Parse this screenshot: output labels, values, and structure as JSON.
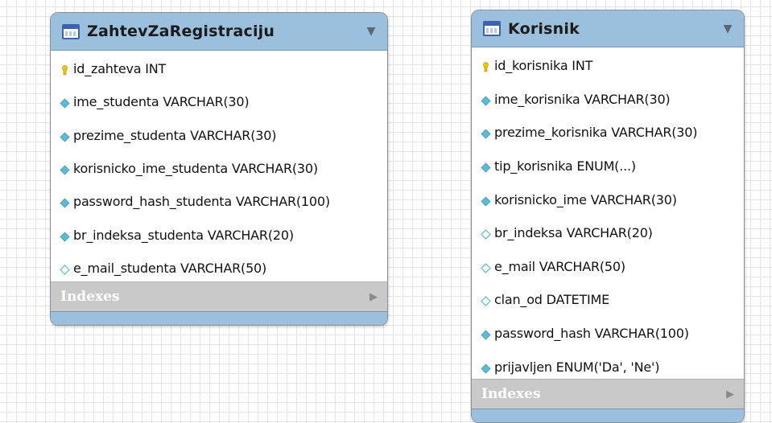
{
  "tables": [
    {
      "name": "ZahtevZaRegistraciju",
      "columns": [
        {
          "text": "id_zahteva INT",
          "marker": "primary-key-icon"
        },
        {
          "text": "ime_studenta VARCHAR(30)",
          "marker": "not-null-column-icon"
        },
        {
          "text": "prezime_studenta VARCHAR(30)",
          "marker": "not-null-column-icon"
        },
        {
          "text": "korisnicko_ime_studenta VARCHAR(30)",
          "marker": "not-null-column-icon"
        },
        {
          "text": "password_hash_studenta VARCHAR(100)",
          "marker": "not-null-column-icon"
        },
        {
          "text": "br_indeksa_studenta VARCHAR(20)",
          "marker": "not-null-column-icon"
        },
        {
          "text": "e_mail_studenta VARCHAR(50)",
          "marker": "nullable-column-icon"
        }
      ],
      "indexes_label": "Indexes"
    },
    {
      "name": "Korisnik",
      "columns": [
        {
          "text": "id_korisnika INT",
          "marker": "primary-key-icon"
        },
        {
          "text": "ime_korisnika VARCHAR(30)",
          "marker": "not-null-column-icon"
        },
        {
          "text": "prezime_korisnika VARCHAR(30)",
          "marker": "not-null-column-icon"
        },
        {
          "text": "tip_korisnika ENUM(...)",
          "marker": "not-null-column-icon"
        },
        {
          "text": "korisnicko_ime VARCHAR(30)",
          "marker": "not-null-column-icon"
        },
        {
          "text": "br_indeksa VARCHAR(20)",
          "marker": "nullable-column-icon"
        },
        {
          "text": "e_mail VARCHAR(50)",
          "marker": "nullable-column-icon"
        },
        {
          "text": "clan_od DATETIME",
          "marker": "nullable-column-icon"
        },
        {
          "text": "password_hash VARCHAR(100)",
          "marker": "not-null-column-icon"
        },
        {
          "text": "prijavljen ENUM('Da', 'Ne')",
          "marker": "not-null-column-icon"
        }
      ],
      "indexes_label": "Indexes"
    }
  ],
  "colors": {
    "header": "#9ac0dd",
    "indexes_bar": "#c9c9c9",
    "key": "#f2c200",
    "column_marker": "#5bbcd6"
  }
}
